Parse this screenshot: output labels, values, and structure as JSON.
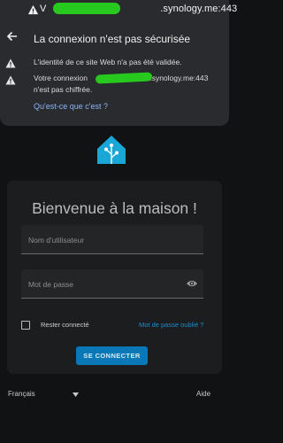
{
  "browser": {
    "url_host_suffix": ".synology.me:443",
    "url_host_prefix": "V"
  },
  "security_popup": {
    "title": "La connexion n'est pas sécurisée",
    "warning_1": "L'identité de ce site Web n'a pas été validée.",
    "warning_2_prefix": "Votre connexion",
    "warning_2_host": ".synology.me:443",
    "warning_2_suffix": "n'est pas chiffrée.",
    "learn_more": "Qu'est-ce que c'est ?"
  },
  "login": {
    "title": "Bienvenue à la maison !",
    "username_placeholder": "Nom d'utilisateur",
    "username_value": "",
    "password_placeholder": "Mot de passe",
    "password_value": "",
    "remember_label": "Rester connecté",
    "remember_checked": false,
    "forgot_link": "Mot de passe oublié ?",
    "submit_label": "SE CONNECTER"
  },
  "footer": {
    "language": "Français",
    "help": "Aide"
  },
  "colors": {
    "accent": "#0a78b6",
    "link": "#1a8fd1",
    "redaction": "#27c91f",
    "background": "#111214"
  },
  "icons": [
    "lock-warning-icon",
    "back-arrow-icon",
    "warning-triangle-icon",
    "home-assistant-logo",
    "eye-icon",
    "caret-down-icon"
  ]
}
